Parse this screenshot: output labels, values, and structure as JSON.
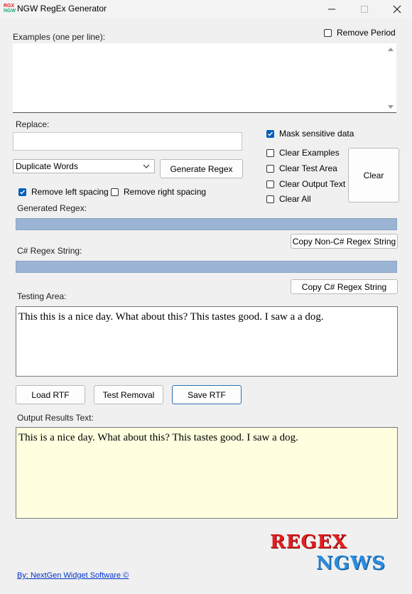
{
  "window": {
    "title": "NGW RegEx Generator",
    "icon_lines": [
      "RGX",
      "NGW"
    ]
  },
  "examples": {
    "label": "Examples (one per line):",
    "value": ""
  },
  "remove_period": {
    "label": "Remove Period",
    "checked": false
  },
  "replace": {
    "label": "Replace:",
    "value": ""
  },
  "mode_select": {
    "value": "Duplicate Words"
  },
  "generate_button": "Generate Regex",
  "remove_left_spacing": {
    "label": "Remove left spacing",
    "checked": true
  },
  "remove_right_spacing": {
    "label": "Remove right spacing",
    "checked": false
  },
  "mask_sensitive": {
    "label": "Mask sensitive data",
    "checked": true
  },
  "clear_options": [
    {
      "label": "Clear Examples",
      "checked": false
    },
    {
      "label": "Clear Test Area",
      "checked": false
    },
    {
      "label": "Clear Output Text",
      "checked": false
    },
    {
      "label": "Clear All",
      "checked": false
    }
  ],
  "clear_button": "Clear",
  "generated_regex": {
    "label": "Generated Regex:",
    "value": ""
  },
  "copy_non_csharp_button": "Copy Non-C# Regex String",
  "csharp_regex": {
    "label": "C# Regex String:",
    "value": ""
  },
  "copy_csharp_button": "Copy C# Regex String",
  "testing_area": {
    "label": "Testing Area:",
    "value": "This this is a nice day. What about this? This tastes good. I saw a a dog."
  },
  "buttons": {
    "load_rtf": "Load RTF",
    "test_removal": "Test Removal",
    "save_rtf": "Save RTF"
  },
  "output": {
    "label": "Output Results Text:",
    "value": "This is a nice day. What about this? This tastes good. I saw a dog."
  },
  "logo": {
    "line1": "REGEX",
    "line2": "NGWS"
  },
  "footer_link": "By: NextGen Widget Software  ©",
  "colors": {
    "accent": "#005fb8",
    "regex_bar": "#9bb4d3",
    "output_bg": "#ffffe0",
    "link": "#0033cc"
  }
}
